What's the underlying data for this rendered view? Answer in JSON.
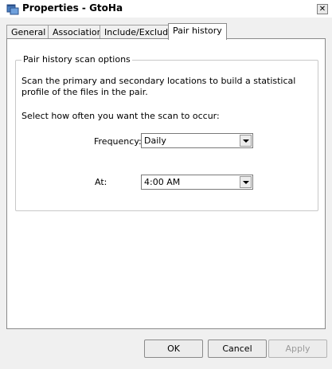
{
  "window": {
    "title": "Properties - GtoHa",
    "close_glyph": "✕"
  },
  "tabs": [
    {
      "label": "General",
      "active": false
    },
    {
      "label": "Associations",
      "active": false
    },
    {
      "label": "Include/Exclude",
      "active": false
    },
    {
      "label": "Pair history",
      "active": true
    }
  ],
  "pair_history": {
    "group_title": "Pair history scan options",
    "description": "Scan the primary and secondary locations to build a statistical profile of the files in the pair.",
    "prompt": "Select how often you want the scan to occur:",
    "frequency": {
      "label": "Frequency:",
      "value": "Daily"
    },
    "at": {
      "label": "At:",
      "value": "4:00 AM"
    }
  },
  "buttons": {
    "ok": "OK",
    "cancel": "Cancel",
    "apply": "Apply"
  },
  "icons": {
    "app": "properties-window-icon",
    "close": "close-icon",
    "dropdown": "chevron-down-icon"
  }
}
